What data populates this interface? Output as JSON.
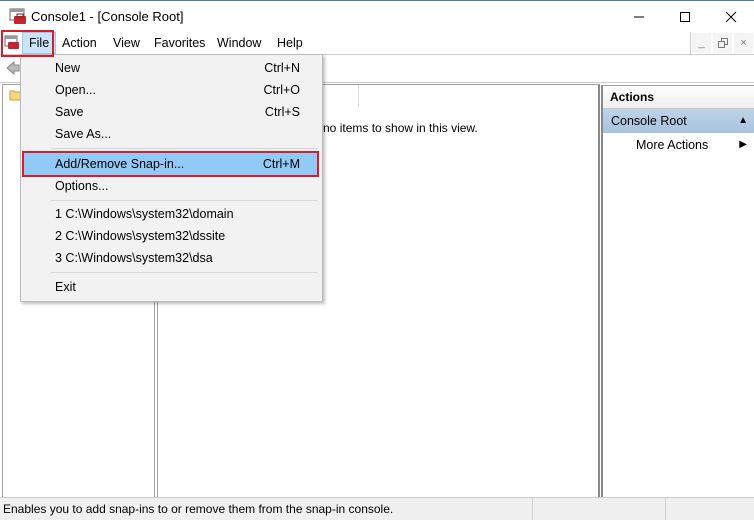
{
  "window": {
    "title": "Console1 - [Console Root]",
    "icons": {
      "app": "mmc-console-icon",
      "minimize": "minimize-icon",
      "maximize": "maximize-icon",
      "close": "close-icon"
    }
  },
  "menubar": {
    "items": [
      {
        "label": "File",
        "active": true
      },
      {
        "label": "Action"
      },
      {
        "label": "View"
      },
      {
        "label": "Favorites"
      },
      {
        "label": "Window"
      },
      {
        "label": "Help"
      }
    ],
    "mdi_buttons": {
      "minimize": "_",
      "restore": "restore-icon",
      "close": "×"
    }
  },
  "file_menu": {
    "items": [
      {
        "label": "New",
        "shortcut": "Ctrl+N"
      },
      {
        "label": "Open...",
        "shortcut": "Ctrl+O"
      },
      {
        "label": "Save",
        "shortcut": "Ctrl+S"
      },
      {
        "label": "Save As...",
        "shortcut": ""
      },
      {
        "label": "Add/Remove Snap-in...",
        "shortcut": "Ctrl+M",
        "highlighted": true
      },
      {
        "label": "Options...",
        "shortcut": ""
      },
      {
        "label": "1 C:\\Windows\\system32\\domain",
        "shortcut": ""
      },
      {
        "label": "2 C:\\Windows\\system32\\dssite",
        "shortcut": ""
      },
      {
        "label": "3 C:\\Windows\\system32\\dsa",
        "shortcut": ""
      },
      {
        "label": "Exit",
        "shortcut": ""
      }
    ]
  },
  "content": {
    "empty_message": "There are no items to show in this view.",
    "visible_message_fragment": "e no items to show in this view."
  },
  "actions_pane": {
    "header": "Actions",
    "section": "Console Root",
    "items": [
      {
        "label": "More Actions"
      }
    ]
  },
  "statusbar": {
    "text": "Enables you to add snap-ins to or remove them from the snap-in console."
  },
  "colors": {
    "highlight_red": "#d11f2d",
    "menu_highlight": "#91c9f7",
    "actions_section": "#b3cbe3"
  }
}
